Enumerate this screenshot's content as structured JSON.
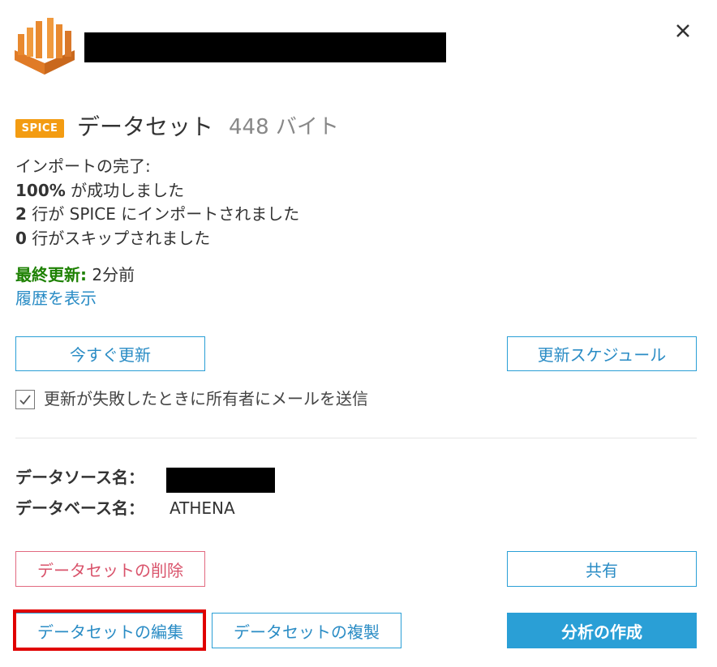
{
  "header": {
    "logo_icon": "aws-quicksight-logo-icon",
    "close_icon": "close-icon"
  },
  "dataset": {
    "badge": "SPICE",
    "label": "データセット",
    "size": "448 バイト"
  },
  "import": {
    "heading": "インポートの完了:",
    "success_pct": "100%",
    "success_text": " が成功しました",
    "rows_count": "2",
    "rows_text": " 行が SPICE にインポートされました",
    "skipped_count": "0",
    "skipped_text": " 行がスキップされました"
  },
  "refresh": {
    "last_label": "最終更新:",
    "last_value": " 2分前",
    "history_link": "履歴を表示",
    "refresh_now": "今すぐ更新",
    "schedule": "更新スケジュール",
    "email_checkbox_label": "更新が失敗したときに所有者にメールを送信",
    "email_checked": true
  },
  "source": {
    "datasource_label": "データソース名：",
    "database_label": "データベース名：",
    "database_value": "ATHENA"
  },
  "actions": {
    "delete": "データセットの削除",
    "share": "共有",
    "edit": "データセットの編集",
    "duplicate": "データセットの複製",
    "create_analysis": "分析の作成"
  },
  "colors": {
    "accent": "#2a9fd6",
    "spice_badge": "#f39c12",
    "danger": "#d9536b",
    "success": "#1d8102",
    "highlight": "#e00000"
  }
}
